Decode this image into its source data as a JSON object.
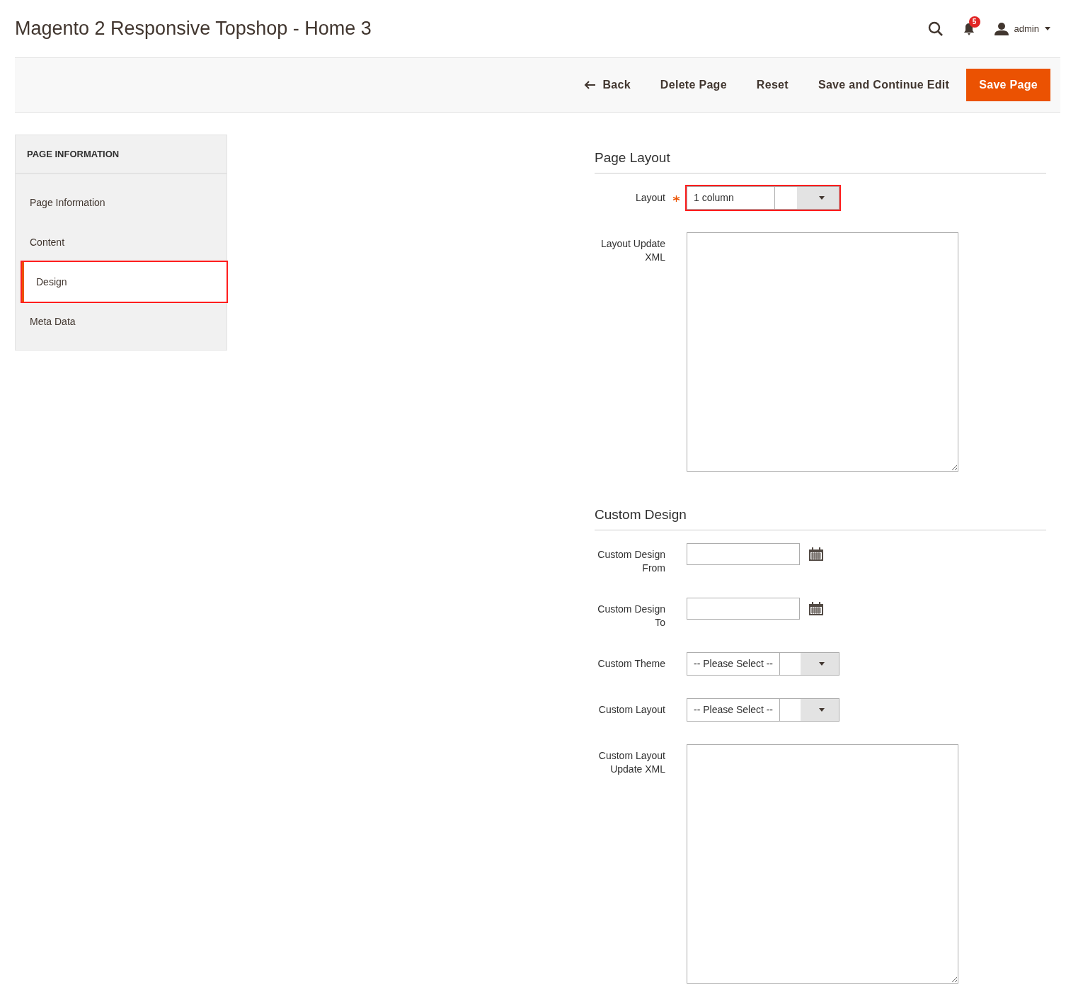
{
  "header": {
    "title": "Magento 2 Responsive Topshop - Home 3",
    "notification_count": "5",
    "user": "admin"
  },
  "actions": [
    {
      "label": "Back",
      "kind": "back"
    },
    {
      "label": "Delete Page",
      "kind": "plain"
    },
    {
      "label": "Reset",
      "kind": "plain"
    },
    {
      "label": "Save and Continue Edit",
      "kind": "plain"
    },
    {
      "label": "Save Page",
      "kind": "primary"
    }
  ],
  "sidebar": {
    "title": "PAGE INFORMATION",
    "items": [
      {
        "label": "Page Information",
        "selected": false,
        "highlighted": false
      },
      {
        "label": "Content",
        "selected": false,
        "highlighted": false
      },
      {
        "label": "Design",
        "selected": true,
        "highlighted": true
      },
      {
        "label": "Meta Data",
        "selected": false,
        "highlighted": false
      }
    ]
  },
  "sections": [
    {
      "title": "Page Layout",
      "fields": [
        {
          "kind": "select",
          "label": "Layout",
          "required": true,
          "value": "1 column",
          "highlighted": true
        },
        {
          "kind": "textarea",
          "label": "Layout Update XML",
          "required": false
        }
      ]
    },
    {
      "title": "Custom Design",
      "fields": [
        {
          "kind": "date",
          "label": "Custom Design From",
          "required": false
        },
        {
          "kind": "date",
          "label": "Custom Design To",
          "required": false
        },
        {
          "kind": "select",
          "label": "Custom Theme",
          "required": false,
          "value": "-- Please Select --",
          "highlighted": false
        },
        {
          "kind": "select",
          "label": "Custom Layout",
          "required": false,
          "value": "-- Please Select --",
          "highlighted": false
        },
        {
          "kind": "textarea",
          "label": "Custom Layout Update XML",
          "required": false
        }
      ]
    }
  ]
}
